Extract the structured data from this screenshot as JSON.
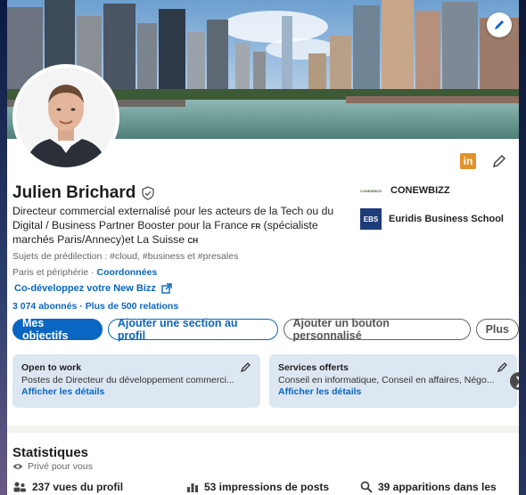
{
  "profile": {
    "name": "Julien Brichard",
    "headline_1": "Directeur commercial externalisé pour les acteurs de la Tech ou du",
    "headline_2": "Digital / Business Partner Booster pour la France",
    "headline_fr": "FR",
    "headline_3": " (spécialiste",
    "headline_4": "marchés Paris/Annecy)et La Suisse",
    "headline_ch": "CH",
    "topics": "Sujets de prédilection : #cloud, #business et #presales",
    "location": "Paris et périphérie · ",
    "contact_link": "Coordonnées",
    "custom_link": "Co-développez votre New Bizz",
    "followers": "3 074 abonnés · Plus de 500 relations",
    "linkedin_badge": "in"
  },
  "orgs": [
    {
      "name": "CONEWBIZZ",
      "logo_text": "CONEWBIZZ"
    },
    {
      "name": "Euridis Business School",
      "logo_text": "EBS"
    }
  ],
  "actions": {
    "primary": "Mes objectifs",
    "add_section": "Ajouter une section au profil",
    "add_button": "Ajouter un bouton personnalisé",
    "more": "Plus"
  },
  "panels": [
    {
      "title": "Open to work",
      "desc": "Postes de Directeur du développement commerci...",
      "link": "Afficher les détails"
    },
    {
      "title": "Services offerts",
      "desc": "Conseil en informatique, Conseil en affaires, Négo...",
      "link": "Afficher les détails"
    }
  ],
  "stats": {
    "title": "Statistiques",
    "private": "Privé pour vous",
    "views": "237 vues du profil",
    "impressions": "53 impressions de posts",
    "appearances": "39 apparitions dans les"
  },
  "colors": {
    "accent": "#0a66c2",
    "panel": "#dde7f1",
    "linkedin_orange": "#e2922a"
  }
}
